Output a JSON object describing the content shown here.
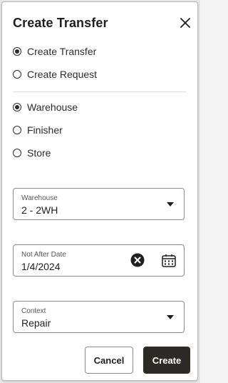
{
  "dialog": {
    "title": "Create Transfer"
  },
  "type_options": [
    {
      "label": "Create Transfer",
      "checked": true
    },
    {
      "label": "Create Request",
      "checked": false
    }
  ],
  "location_options": [
    {
      "label": "Warehouse",
      "checked": true
    },
    {
      "label": "Finisher",
      "checked": false
    },
    {
      "label": "Store",
      "checked": false
    }
  ],
  "warehouse_field": {
    "label": "Warehouse",
    "value": "2 - 2WH"
  },
  "date_field": {
    "label": "Not After Date",
    "value": "1/4/2024"
  },
  "context_field": {
    "label": "Context",
    "value": "Repair"
  },
  "actions": {
    "cancel_label": "Cancel",
    "create_label": "Create"
  },
  "colors": {
    "primary_button": "#2e2a26",
    "text": "#1f1f1f",
    "border": "#8c8c8c"
  }
}
